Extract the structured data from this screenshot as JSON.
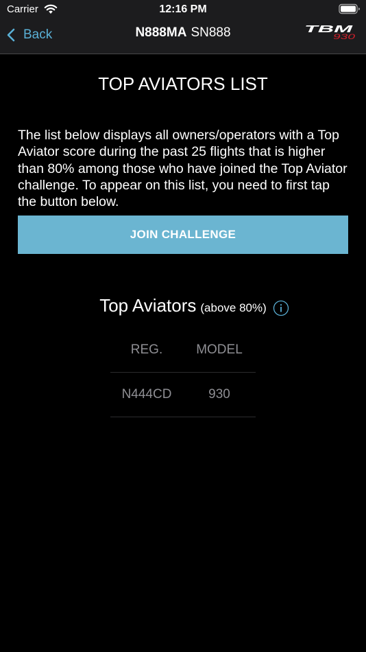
{
  "status_bar": {
    "carrier": "Carrier",
    "time": "12:16 PM"
  },
  "nav": {
    "back_label": "Back",
    "registration": "N888MA",
    "serial": "SN888",
    "logo_text": "TBM",
    "logo_subtext": "930"
  },
  "heading": "TOP AVIATORS LIST",
  "description": "The list below displays all owners/operators with a Top Aviator score during the past 25 flights that is higher than 80% among those who have joined the Top Aviator challenge. To appear on this list, you need to first tap the button below.",
  "join_button_label": "JOIN CHALLENGE",
  "section": {
    "title": "Top Aviators",
    "subtitle": "(above 80%)",
    "info_icon": "info-icon"
  },
  "table": {
    "headers": [
      "REG.",
      "MODEL"
    ],
    "rows": [
      {
        "reg": "N444CD",
        "model": "930"
      }
    ]
  },
  "colors": {
    "accent": "#5ab0d6",
    "button_bg": "#6bb5d1",
    "background": "#000000",
    "bar_bg": "#1c1c1e",
    "logo_red": "#d0202b"
  }
}
